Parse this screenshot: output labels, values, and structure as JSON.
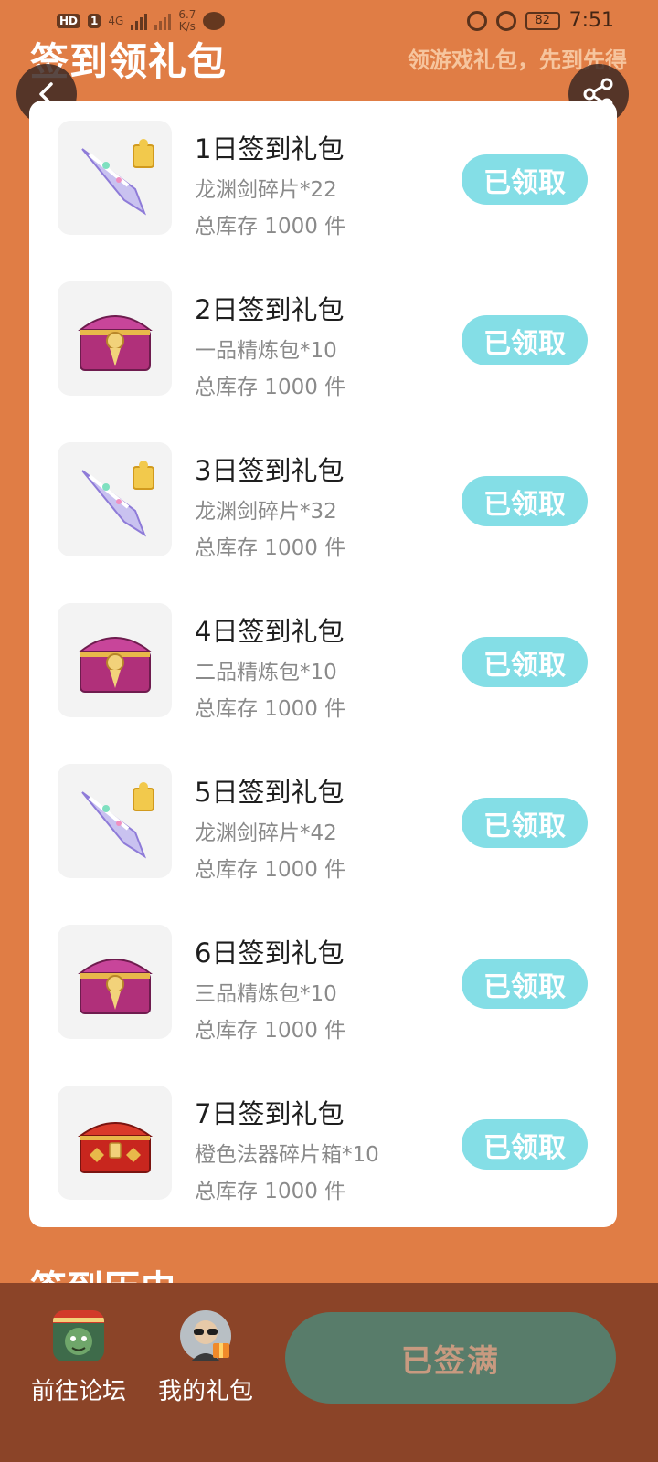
{
  "status_bar": {
    "hd_badge": "HD",
    "sim_badge": "1",
    "network": "4G",
    "speed_value": "6.7",
    "speed_unit": "K/s",
    "battery": "82",
    "time": "7:51"
  },
  "header": {
    "title": "签到领礼包",
    "subtitle": "领游戏礼包，先到先得"
  },
  "gifts": [
    {
      "title": "1日签到礼包",
      "item": "龙渊剑碎片*22",
      "stock": "总库存 1000 件",
      "button": "已领取",
      "icon": "sword-fragment-icon"
    },
    {
      "title": "2日签到礼包",
      "item": "一品精炼包*10",
      "stock": "总库存 1000 件",
      "button": "已领取",
      "icon": "treasure-chest-icon"
    },
    {
      "title": "3日签到礼包",
      "item": "龙渊剑碎片*32",
      "stock": "总库存 1000 件",
      "button": "已领取",
      "icon": "sword-fragment-icon"
    },
    {
      "title": "4日签到礼包",
      "item": "二品精炼包*10",
      "stock": "总库存 1000 件",
      "button": "已领取",
      "icon": "treasure-chest-icon"
    },
    {
      "title": "5日签到礼包",
      "item": "龙渊剑碎片*42",
      "stock": "总库存 1000 件",
      "button": "已领取",
      "icon": "sword-fragment-icon"
    },
    {
      "title": "6日签到礼包",
      "item": "三品精炼包*10",
      "stock": "总库存 1000 件",
      "button": "已领取",
      "icon": "treasure-chest-icon"
    },
    {
      "title": "7日签到礼包",
      "item": "橙色法器碎片箱*10",
      "stock": "总库存 1000 件",
      "button": "已领取",
      "icon": "red-chest-icon"
    }
  ],
  "section": {
    "history_title": "签到历史"
  },
  "bottom_bar": {
    "forum_label": "前往论坛",
    "my_gifts_label": "我的礼包",
    "signed_button": "已签满"
  },
  "colors": {
    "background": "#E07D45",
    "claim_button": "#84DEE6",
    "bottom_bar": "#8B4428",
    "signed_button": "#587C6A"
  }
}
